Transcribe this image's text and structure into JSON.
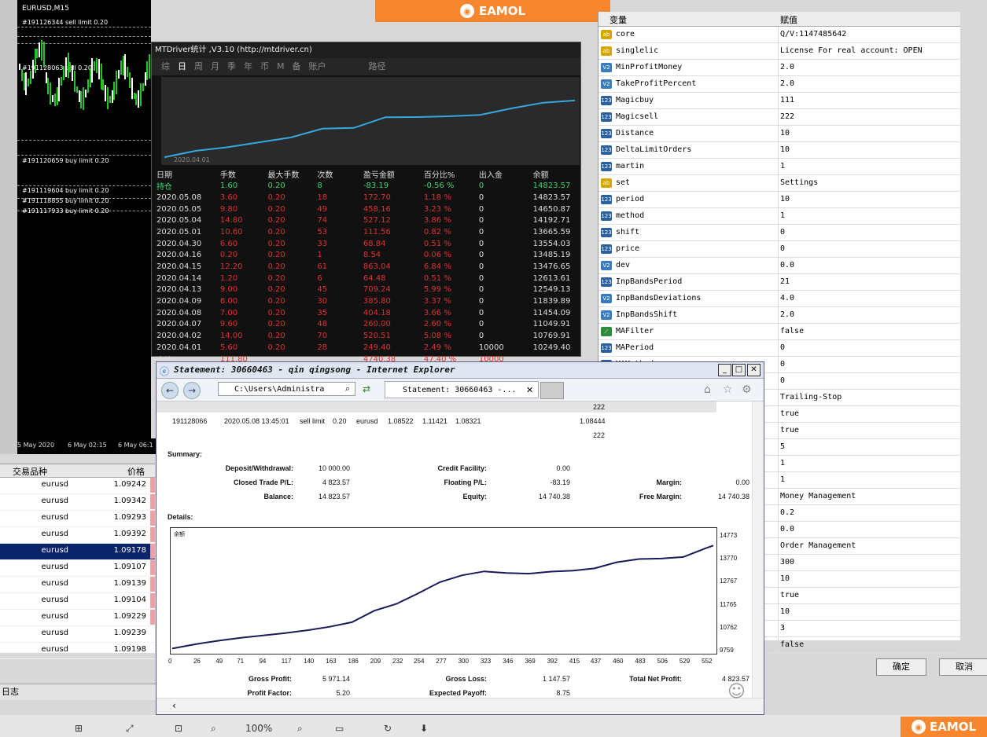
{
  "chart": {
    "symbol": "EURUSD,M15",
    "orders": [
      {
        "label": "#191126344 sell limit 0.20"
      },
      {
        "label": "#191128063 sell 0.20"
      },
      {
        "label": "#191120659 buy limit 0.20"
      },
      {
        "label": "#191119604 buy limit 0.20"
      },
      {
        "label": "#191118855 buy limit 0.20"
      },
      {
        "label": "#191117933 buy limit 0.20"
      }
    ],
    "xlabels": [
      "5 May 2020",
      "6 May 02:15",
      "6 May 06:1"
    ]
  },
  "banner": {
    "text": "EAMOL"
  },
  "mtdriver": {
    "title": "MTDriver统计 ,V3.10 (http://mtdriver.cn)",
    "tabs": [
      "综",
      "日",
      "周",
      "月",
      "季",
      "年",
      "币",
      "M",
      "备",
      "账户",
      "路径"
    ],
    "active_tab": "日",
    "chart_start": "2020.04.01",
    "headers": [
      "日期",
      "手数",
      "最大手数",
      "次数",
      "盈亏金额",
      "百分比%",
      "出入金",
      "余额"
    ],
    "holding": [
      "持仓",
      "1.60",
      "0.20",
      "8",
      "-83.19",
      "-0.56 %",
      "0",
      "14823.57"
    ],
    "rows": [
      [
        "2020.05.08",
        "3.60",
        "0.20",
        "18",
        "172.70",
        "1.18 %",
        "0",
        "14823.57"
      ],
      [
        "2020.05.05",
        "9.80",
        "0.20",
        "49",
        "458.16",
        "3.23 %",
        "0",
        "14650.87"
      ],
      [
        "2020.05.04",
        "14.80",
        "0.20",
        "74",
        "527.12",
        "3.86 %",
        "0",
        "14192.71"
      ],
      [
        "2020.05.01",
        "10.60",
        "0.20",
        "53",
        "111.56",
        "0.82 %",
        "0",
        "13665.59"
      ],
      [
        "2020.04.30",
        "6.60",
        "0.20",
        "33",
        "68.84",
        "0.51 %",
        "0",
        "13554.03"
      ],
      [
        "2020.04.16",
        "0.20",
        "0.20",
        "1",
        "8.54",
        "0.06 %",
        "0",
        "13485.19"
      ],
      [
        "2020.04.15",
        "12.20",
        "0.20",
        "61",
        "863.04",
        "6.84 %",
        "0",
        "13476.65"
      ],
      [
        "2020.04.14",
        "1.20",
        "0.20",
        "6",
        "64.48",
        "0.51 %",
        "0",
        "12613.61"
      ],
      [
        "2020.04.13",
        "9.00",
        "0.20",
        "45",
        "709.24",
        "5.99 %",
        "0",
        "12549.13"
      ],
      [
        "2020.04.09",
        "6.00",
        "0.20",
        "30",
        "385.80",
        "3.37 %",
        "0",
        "11839.89"
      ],
      [
        "2020.04.08",
        "7.00",
        "0.20",
        "35",
        "404.18",
        "3.66 %",
        "0",
        "11454.09"
      ],
      [
        "2020.04.07",
        "9.60",
        "0.20",
        "48",
        "260.00",
        "2.60 %",
        "0",
        "11049.91"
      ],
      [
        "2020.04.02",
        "14.00",
        "0.20",
        "70",
        "520.51",
        "5.08 %",
        "0",
        "10769.91"
      ],
      [
        "2020.04.01",
        "5.60",
        "0.20",
        "28",
        "249.40",
        "2.49 %",
        "10000",
        "10249.40"
      ]
    ],
    "total": [
      "合计",
      "111.80",
      "",
      "",
      "4740.38",
      "47.40 %",
      "10000",
      ""
    ],
    "balance_curve": [
      10249.4,
      10769.91,
      11049.91,
      11454.09,
      11839.89,
      12549.13,
      12613.61,
      13476.65,
      13485.19,
      13554.03,
      13665.59,
      14192.71,
      14650.87,
      14823.57
    ]
  },
  "pricelist": {
    "headers": [
      "交易品种",
      "价格"
    ],
    "rows": [
      {
        "sym": "eurusd",
        "price": "1.09242"
      },
      {
        "sym": "eurusd",
        "price": "1.09342"
      },
      {
        "sym": "eurusd",
        "price": "1.09293"
      },
      {
        "sym": "eurusd",
        "price": "1.09392"
      },
      {
        "sym": "eurusd",
        "price": "1.09178"
      },
      {
        "sym": "eurusd",
        "price": "1.09107"
      },
      {
        "sym": "eurusd",
        "price": "1.09139"
      },
      {
        "sym": "eurusd",
        "price": "1.09104"
      },
      {
        "sym": "eurusd",
        "price": "1.09229"
      },
      {
        "sym": "eurusd",
        "price": "1.09239"
      },
      {
        "sym": "eurusd",
        "price": "1.09198"
      }
    ],
    "selected_index": 4,
    "status": "日志"
  },
  "toolbar": {
    "zoom": "100%"
  },
  "params": {
    "headers": [
      "变量",
      "赋值"
    ],
    "rows": [
      {
        "type": "ab",
        "name": "core",
        "value": "Q/V:1147485642"
      },
      {
        "type": "ab",
        "name": "singlelic",
        "value": "License For real account: OPEN"
      },
      {
        "type": "v2",
        "name": "MinProfitMoney",
        "value": "2.0"
      },
      {
        "type": "v2",
        "name": "TakeProfitPercent",
        "value": "2.0"
      },
      {
        "type": "123",
        "name": "Magicbuy",
        "value": "111"
      },
      {
        "type": "123",
        "name": "Magicsell",
        "value": "222"
      },
      {
        "type": "123",
        "name": "Distance",
        "value": "10"
      },
      {
        "type": "123",
        "name": "DeltaLimitOrders",
        "value": "10"
      },
      {
        "type": "123",
        "name": "martin",
        "value": "1"
      },
      {
        "type": "ab",
        "name": "set",
        "value": "Settings"
      },
      {
        "type": "123",
        "name": "period",
        "value": "10"
      },
      {
        "type": "123",
        "name": "method",
        "value": "1"
      },
      {
        "type": "123",
        "name": "shift",
        "value": "0"
      },
      {
        "type": "123",
        "name": "price",
        "value": "0"
      },
      {
        "type": "v2",
        "name": "dev",
        "value": "0.0"
      },
      {
        "type": "123",
        "name": "InpBandsPeriod",
        "value": "21"
      },
      {
        "type": "v2",
        "name": "InpBandsDeviations",
        "value": "4.0"
      },
      {
        "type": "v2",
        "name": "InpBandsShift",
        "value": "2.0"
      },
      {
        "type": "bool",
        "name": "MAFilter",
        "value": "false"
      },
      {
        "type": "123",
        "name": "MAPeriod",
        "value": "0"
      },
      {
        "type": "123",
        "name": "MAMethod",
        "value": "0"
      },
      {
        "type": "",
        "name": "",
        "value": "0"
      },
      {
        "type": "",
        "name": "",
        "value": "Trailing-Stop"
      },
      {
        "type": "",
        "name": "",
        "value": "true"
      },
      {
        "type": "",
        "name": "",
        "value": "true"
      },
      {
        "type": "",
        "name": "",
        "value": "5"
      },
      {
        "type": "",
        "name": "",
        "value": "1"
      },
      {
        "type": "",
        "name": "",
        "value": "1"
      },
      {
        "type": "",
        "name": "",
        "value": "Money Management"
      },
      {
        "type": "",
        "name": "",
        "value": "0.2"
      },
      {
        "type": "",
        "name": "",
        "value": "0.0"
      },
      {
        "type": "",
        "name": "",
        "value": "Order Management"
      },
      {
        "type": "",
        "name": "",
        "value": "300"
      },
      {
        "type": "",
        "name": "",
        "value": "10"
      },
      {
        "type": "",
        "name": "",
        "value": "true"
      },
      {
        "type": "",
        "name": "",
        "value": "10"
      },
      {
        "type": "",
        "name": "",
        "value": "3"
      },
      {
        "type": "",
        "name": "",
        "value": "false"
      }
    ],
    "ok_label": "确定",
    "cancel_label": "取消"
  },
  "ie": {
    "title": "Statement: 30660463 - qin qingsong - Internet Explorer",
    "address": "C:\\Users\\Administra",
    "tab_label": "Statement: 30660463 -...",
    "top_cell": "222",
    "trade": [
      "191128066",
      "2020.05.08 13:45:01",
      "sell limit",
      "0.20",
      "eurusd",
      "1.08522",
      "1.11421",
      "1.08321",
      "1.08444"
    ],
    "trade_magic": "222",
    "summary_label": "Summary:",
    "summary": {
      "deposit_label": "Deposit/Withdrawal:",
      "deposit": "10 000.00",
      "credit_label": "Credit Facility:",
      "credit": "0.00",
      "closed_label": "Closed Trade P/L:",
      "closed": "4 823.57",
      "floating_label": "Floating P/L:",
      "floating": "-83.19",
      "margin_label": "Margin:",
      "margin": "0.00",
      "balance_label": "Balance:",
      "balance": "14 823.57",
      "equity_label": "Equity:",
      "equity": "14 740.38",
      "free_label": "Free Margin:",
      "free": "14 740.38"
    },
    "details_label": "Details:",
    "graph_legend": "余额",
    "gross_profit_label": "Gross Profit:",
    "gross_profit": "5 971.14",
    "gross_loss_label": "Gross Loss:",
    "gross_loss": "1 147.57",
    "net_profit_label": "Total Net Profit:",
    "net_profit": "4 823.57",
    "profit_factor_label": "Profit Factor:",
    "profit_factor": "5.20",
    "expected_label": "Expected Payoff:",
    "expected": "8.75"
  },
  "chart_data": {
    "type": "line",
    "title": "",
    "xlabel": "",
    "ylabel": "",
    "x_ticks": [
      "0",
      "26",
      "49",
      "71",
      "94",
      "117",
      "140",
      "163",
      "186",
      "209",
      "232",
      "254",
      "277",
      "300",
      "323",
      "346",
      "369",
      "392",
      "415",
      "437",
      "460",
      "483",
      "506",
      "529",
      "552"
    ],
    "y_ticks": [
      "14773",
      "13770",
      "12767",
      "11765",
      "10762",
      "9759"
    ],
    "xlim": [
      0,
      560
    ],
    "ylim": [
      9759,
      14773
    ],
    "series": [
      {
        "name": "余额",
        "x": [
          0,
          26,
          49,
          71,
          94,
          117,
          140,
          163,
          186,
          209,
          232,
          254,
          277,
          300,
          323,
          346,
          369,
          392,
          415,
          437,
          460,
          483,
          506,
          529,
          552,
          560
        ],
        "y": [
          9850,
          10050,
          10200,
          10320,
          10420,
          10520,
          10650,
          10800,
          11000,
          11500,
          11800,
          12250,
          12750,
          13050,
          13220,
          13150,
          13120,
          13210,
          13250,
          13350,
          13620,
          13760,
          13780,
          13850,
          14230,
          14350
        ]
      }
    ]
  }
}
